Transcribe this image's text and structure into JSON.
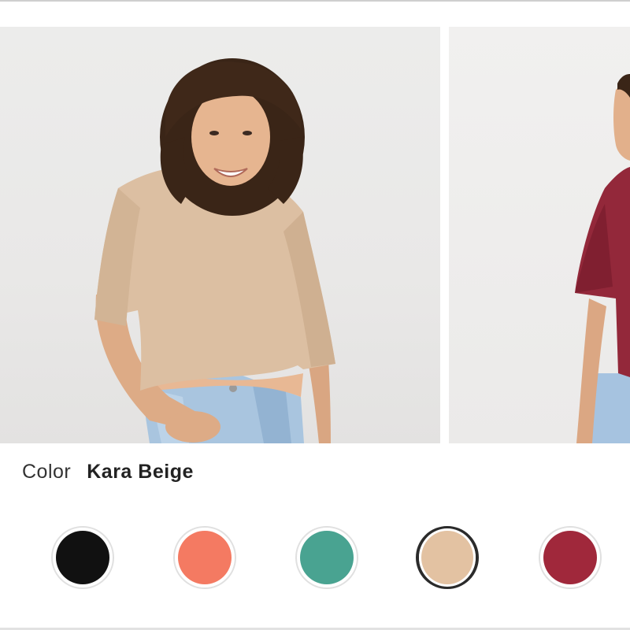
{
  "product_gallery": {
    "images": [
      {
        "icon": "model-beige-tee-photo-icon"
      },
      {
        "icon": "model-burgundy-tee-photo-icon"
      }
    ]
  },
  "color_selector": {
    "label": "Color",
    "selected_name": "Kara Beige",
    "swatches": [
      {
        "hex": "#111111",
        "selected": false
      },
      {
        "hex": "#f47a62",
        "selected": false
      },
      {
        "hex": "#49a391",
        "selected": false
      },
      {
        "hex": "#e3c2a2",
        "selected": true
      },
      {
        "hex": "#a0283b",
        "selected": false
      }
    ]
  },
  "colors": {
    "selected_ring": "#2b2b2b",
    "unselected_ring": "#e0e0e0"
  }
}
